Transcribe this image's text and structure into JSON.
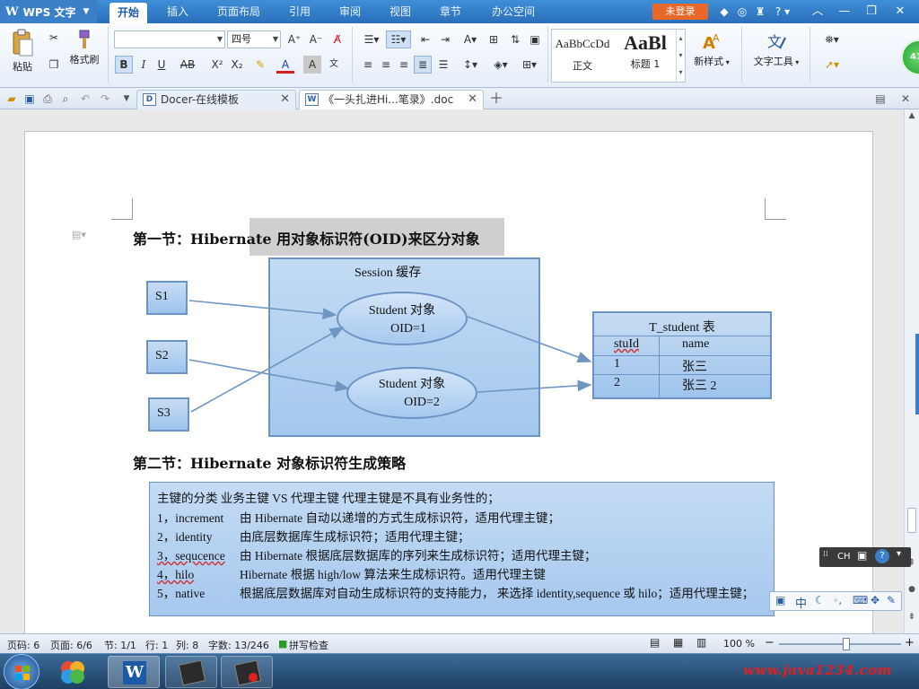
{
  "app": {
    "name": "WPS 文字",
    "login_label": "未登录",
    "menu": [
      "开始",
      "插入",
      "页面布局",
      "引用",
      "审阅",
      "视图",
      "章节",
      "办公空间"
    ]
  },
  "ribbon": {
    "paste": "粘贴",
    "format_painter": "格式刷",
    "font_name": "",
    "font_size": "四号",
    "styles": [
      {
        "preview": "AaBbCcDd",
        "label": "正文"
      },
      {
        "preview": "AaBl",
        "label": "标题 1"
      }
    ],
    "new_style": "新样式",
    "text_tools": "文字工具"
  },
  "tabs": [
    {
      "label": "Docer-在线模板"
    },
    {
      "label": "《一头扎进Hi...笔录》.doc"
    }
  ],
  "document": {
    "heading1": "第一节：Hibernate 用对象标识符(OID)来区分对象",
    "diagram": {
      "session_label": "Session 缓存",
      "sessions": [
        "S1",
        "S2",
        "S3"
      ],
      "objects": [
        {
          "name": "Student 对象",
          "oid": "OID=1"
        },
        {
          "name": "Student 对象",
          "oid": "OID=2"
        }
      ],
      "table": {
        "title": "T_student 表",
        "headers": [
          "stuId",
          "name"
        ],
        "rows": [
          [
            "1",
            "张三"
          ],
          [
            "2",
            "张三 2"
          ]
        ]
      }
    },
    "heading2": "第二节：Hibernate 对象标识符生成策略",
    "strategy": {
      "intro": "主键的分类   业务主键 VS 代理主键    代理主键是不具有业务性的；",
      "items": [
        {
          "key": "1，increment",
          "desc": "由 Hibernate 自动以递增的方式生成标识符，适用代理主键；"
        },
        {
          "key": "2，identity",
          "desc": "由底层数据库生成标识符；适用代理主键；"
        },
        {
          "key": "3，sequcence",
          "desc": "由 Hibernate 根据底层数据库的序列来生成标识符；适用代理主键；"
        },
        {
          "key": "4，hilo",
          "desc": "Hibernate 根据 high/low 算法来生成标识符。适用代理主键"
        },
        {
          "key": "5，native",
          "desc": "根据底层数据库对自动生成标识符的支持能力，  来选择 identity,sequence 或 hilo；适用代理主键；"
        }
      ]
    }
  },
  "ime": {
    "lang": "CH",
    "mode": "中"
  },
  "status": {
    "page_no": "页码: 6",
    "page": "页面: 6/6",
    "section": "节: 1/1",
    "row": "行: 1",
    "col": "列: 8",
    "words": "字数: 13/246",
    "spell": "拼写检查",
    "zoom": "100 %",
    "zoom_level": 0.55
  },
  "taskbar": {
    "watermark": "www.java1234.com"
  },
  "colors": {
    "accent": "#2a6fba",
    "diagram_fill": "#a9cbf0",
    "diagram_border": "#6b93c4",
    "login": "#e8682a",
    "watermark": "#e02020"
  }
}
